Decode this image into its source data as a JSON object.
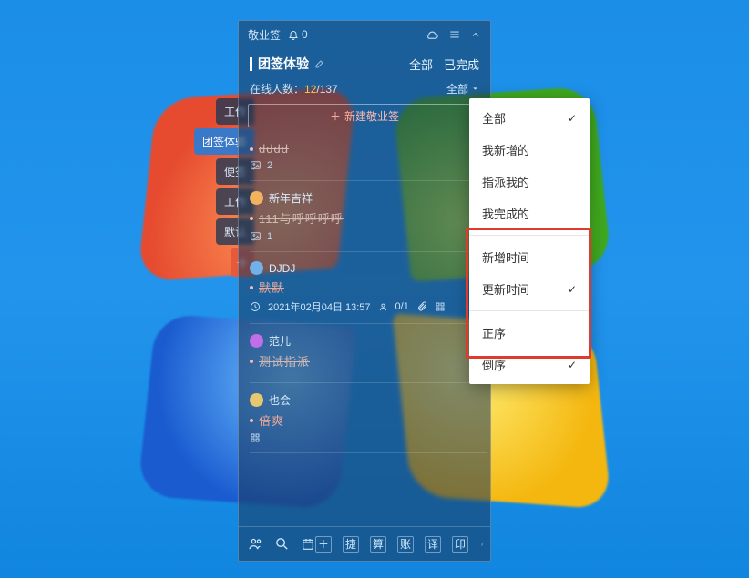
{
  "app": {
    "title": "敬业签",
    "bell_count": "0"
  },
  "sidetabs": {
    "items": [
      {
        "label": "工作"
      },
      {
        "label": "团签体验"
      },
      {
        "label": "便签"
      },
      {
        "label": "工作"
      },
      {
        "label": "默认"
      }
    ]
  },
  "group": {
    "name": "团签体验",
    "filter_all": "全部",
    "filter_done": "已完成"
  },
  "online": {
    "label": "在线人数：",
    "current": "12",
    "sep": "/",
    "total": "137",
    "dropdown": "全部"
  },
  "newnote": {
    "label": "新建敬业签"
  },
  "notes": [
    {
      "text": "dddd",
      "strike": true,
      "meta_icon": "image",
      "meta_count": "2"
    },
    {
      "author": "新年吉祥",
      "avatar": "a",
      "text": "111与呼呼呼呼",
      "strike": true,
      "meta_icon": "image",
      "meta_count": "1"
    },
    {
      "author": "DJDJ",
      "avatar": "b",
      "text": "默默",
      "strike": true,
      "variant": 2,
      "date": "2021年02月04日 13:57",
      "people": "0/1",
      "extras": true
    },
    {
      "author": "范儿",
      "avatar": "c",
      "text": "测试指派",
      "strike": true
    },
    {
      "author": "也会",
      "avatar": "d",
      "text": "倍爽",
      "strike": true,
      "variant": 2,
      "tail_icon": true
    }
  ],
  "footer": {
    "btn_add": "＋",
    "btns": [
      "捷",
      "算",
      "账",
      "译",
      "印"
    ]
  },
  "menu": {
    "group1": [
      {
        "label": "全部",
        "checked": true
      },
      {
        "label": "我新增的"
      },
      {
        "label": "指派我的"
      },
      {
        "label": "我完成的"
      }
    ],
    "group2": [
      {
        "label": "新增时间"
      },
      {
        "label": "更新时间",
        "checked": true
      }
    ],
    "group3": [
      {
        "label": "正序"
      },
      {
        "label": "倒序",
        "checked": true
      }
    ]
  }
}
